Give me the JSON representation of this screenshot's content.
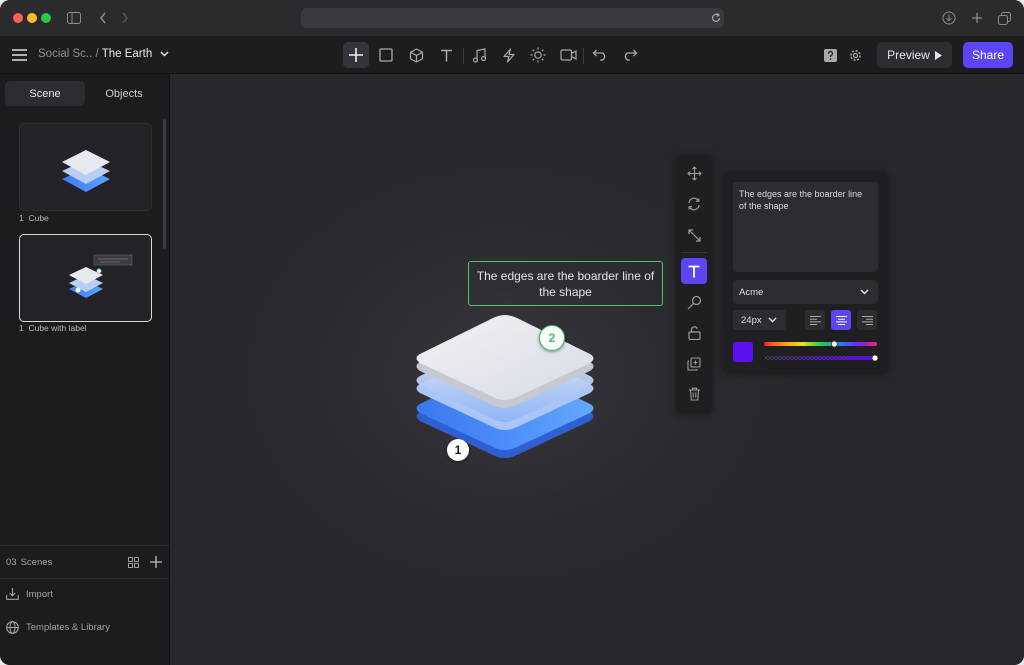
{
  "project": {
    "folder": "Social Sc..",
    "separator": "/",
    "name": "The Earth"
  },
  "topbar": {
    "preview_label": "Preview",
    "share_label": "Share"
  },
  "sidebar": {
    "tabs": [
      {
        "label": "Scene"
      },
      {
        "label": "Objects"
      }
    ],
    "scenes": [
      {
        "number": "1",
        "label": "Cube"
      },
      {
        "number": "1",
        "label": "Cube with label"
      }
    ],
    "scenes_count": "03",
    "scenes_label": "Scenes",
    "import_label": "Import",
    "templates_label": "Templates & Library"
  },
  "canvas": {
    "label_text": "The edges are the boarder line of the shape",
    "badge_1": "1",
    "badge_2": "2"
  },
  "text_panel": {
    "text": "The edges are the boarder line of the shape",
    "font": "Acme",
    "size": "24px",
    "alignment": "center",
    "color": "#5b10f0",
    "hue_position": 0.63,
    "opacity_position": 1.0
  },
  "colors": {
    "accent": "#5b45f5",
    "label_border": "#4cc56a",
    "badge_2": "#3bbf5c"
  }
}
